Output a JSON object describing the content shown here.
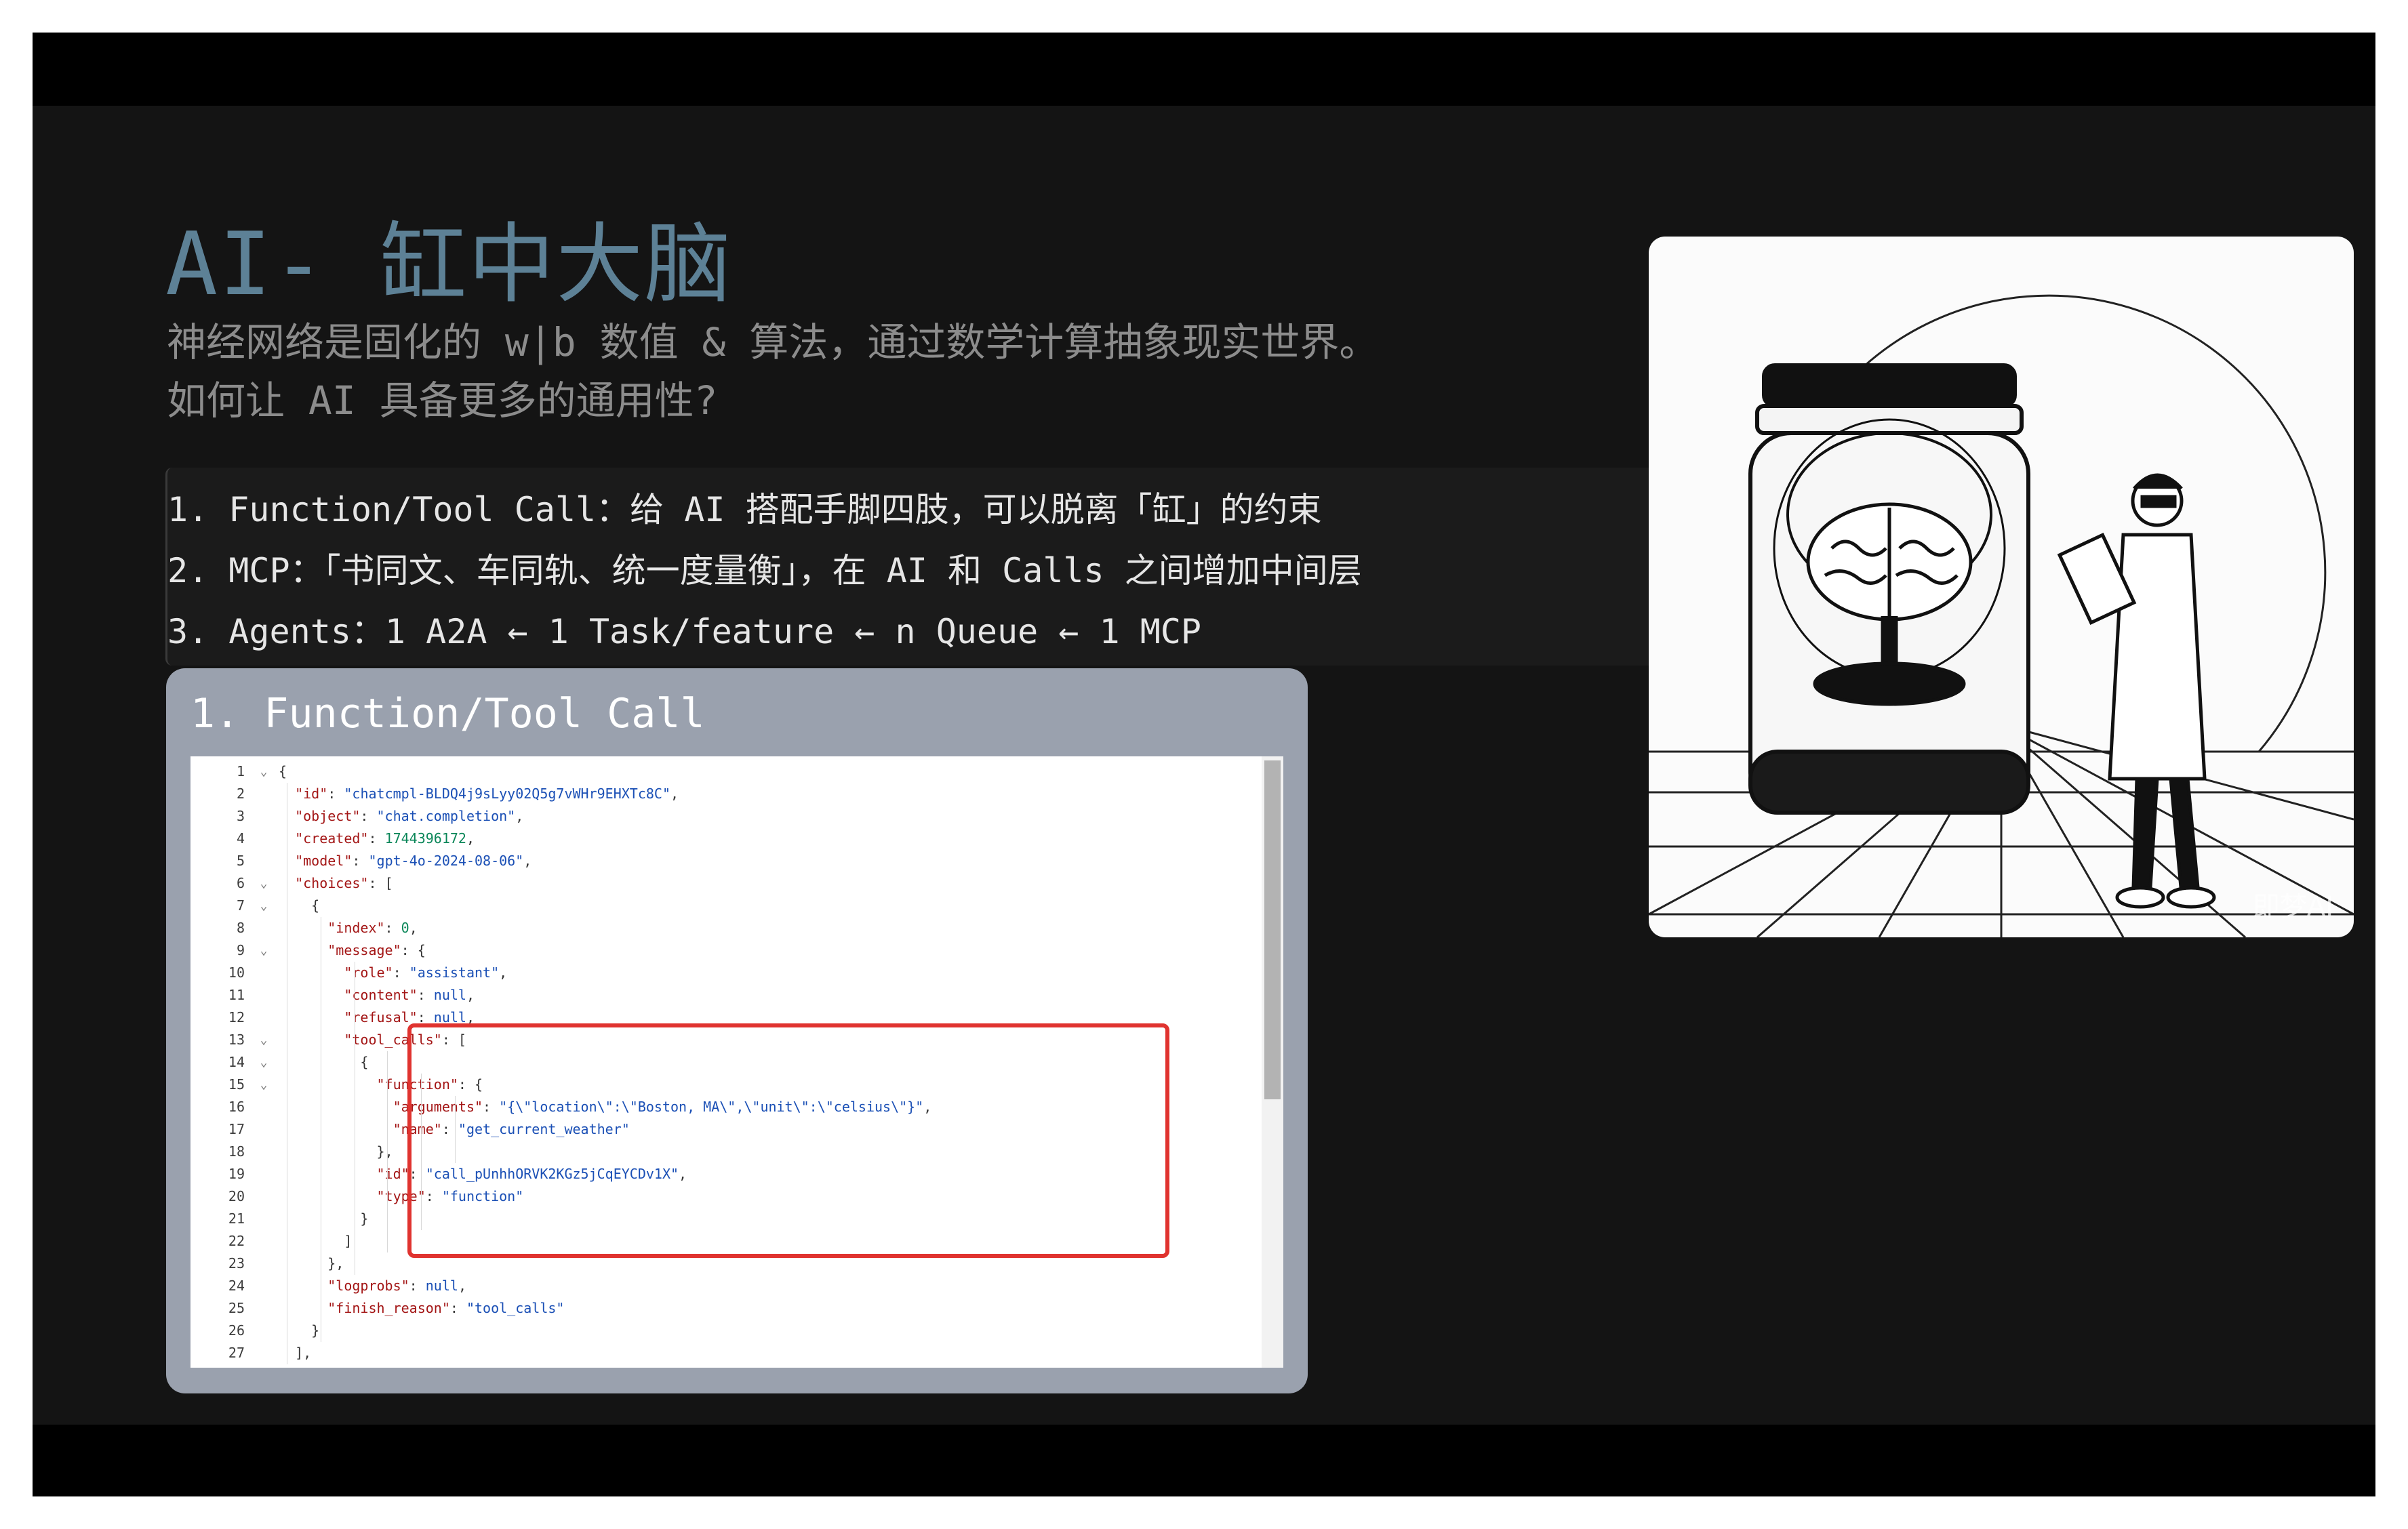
{
  "slide": {
    "title": "AI- 缸中大脑",
    "subtitle_lines": [
      "神经网络是固化的 w|b 数值 & 算法，通过数学计算抽象现实世界。",
      "如何让 AI 具备更多的通用性?"
    ],
    "list_items": [
      "1. Function/Tool Call：给 AI 搭配手脚四肢，可以脱离「缸」的约束",
      "2. MCP：「书同文、车同轨、统一度量衡」，在 AI 和 Calls 之间增加中间层",
      "3. Agents：1 A2A ← 1 Task/feature ← n Queue ← 1 MCP"
    ]
  },
  "code_card": {
    "title": "1. Function/Tool Call",
    "lines": [
      {
        "n": "1",
        "fold": "⌄",
        "text": "{"
      },
      {
        "n": "2",
        "fold": "",
        "text": "  \"id\": \"chatcmpl-BLDQ4j9sLyy02Q5g7vWHr9EHXTc8C\","
      },
      {
        "n": "3",
        "fold": "",
        "text": "  \"object\": \"chat.completion\","
      },
      {
        "n": "4",
        "fold": "",
        "text": "  \"created\": 1744396172,"
      },
      {
        "n": "5",
        "fold": "",
        "text": "  \"model\": \"gpt-4o-2024-08-06\","
      },
      {
        "n": "6",
        "fold": "⌄",
        "text": "  \"choices\": ["
      },
      {
        "n": "7",
        "fold": "⌄",
        "text": "    {"
      },
      {
        "n": "8",
        "fold": "",
        "text": "      \"index\": 0,"
      },
      {
        "n": "9",
        "fold": "⌄",
        "text": "      \"message\": {"
      },
      {
        "n": "10",
        "fold": "",
        "text": "        \"role\": \"assistant\","
      },
      {
        "n": "11",
        "fold": "",
        "text": "        \"content\": null,"
      },
      {
        "n": "12",
        "fold": "",
        "text": "        \"refusal\": null,"
      },
      {
        "n": "13",
        "fold": "⌄",
        "text": "        \"tool_calls\": ["
      },
      {
        "n": "14",
        "fold": "⌄",
        "text": "          {"
      },
      {
        "n": "15",
        "fold": "⌄",
        "text": "            \"function\": {"
      },
      {
        "n": "16",
        "fold": "",
        "text": "              \"arguments\": \"{\\\"location\\\":\\\"Boston, MA\\\",\\\"unit\\\":\\\"celsius\\\"}\","
      },
      {
        "n": "17",
        "fold": "",
        "text": "              \"name\": \"get_current_weather\""
      },
      {
        "n": "18",
        "fold": "",
        "text": "            },"
      },
      {
        "n": "19",
        "fold": "",
        "text": "            \"id\": \"call_pUnhhORVK2KGz5jCqEYCDv1X\","
      },
      {
        "n": "20",
        "fold": "",
        "text": "            \"type\": \"function\""
      },
      {
        "n": "21",
        "fold": "",
        "text": "          }"
      },
      {
        "n": "22",
        "fold": "",
        "text": "        ]"
      },
      {
        "n": "23",
        "fold": "",
        "text": "      },"
      },
      {
        "n": "24",
        "fold": "",
        "text": "      \"logprobs\": null,"
      },
      {
        "n": "25",
        "fold": "",
        "text": "      \"finish_reason\": \"tool_calls\""
      },
      {
        "n": "26",
        "fold": "",
        "text": "    }"
      },
      {
        "n": "27",
        "fold": "",
        "text": "  ],"
      }
    ]
  },
  "illustration": {
    "watermark": "即梦AI"
  },
  "colors": {
    "slide_background": "#141414",
    "title": "#5d8196",
    "subtitle": "#8c8c8c",
    "list_text": "#e6e6e6",
    "code_card": "#9aa1ae",
    "highlight": "#e0332f"
  }
}
